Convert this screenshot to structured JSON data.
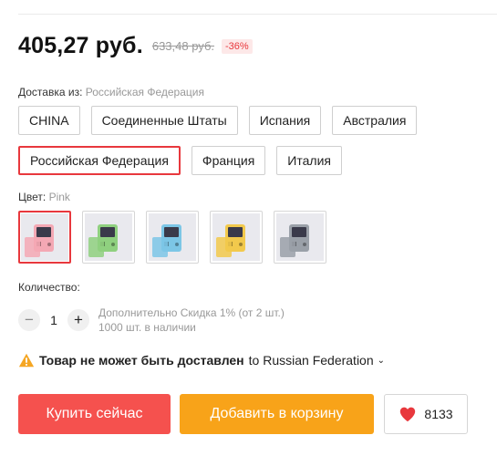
{
  "price": {
    "current": "405,27 руб.",
    "old": "633,48 руб.",
    "discount": "-36%"
  },
  "shipping": {
    "label": "Доставка из:",
    "selected": "Российская Федерация",
    "options": [
      "CHINA",
      "Соединенные Штаты",
      "Испания",
      "Австралия",
      "Российская Федерация",
      "Франция",
      "Италия"
    ],
    "active_index": 4
  },
  "color": {
    "label": "Цвет:",
    "selected": "Pink",
    "swatches": [
      {
        "name": "pink",
        "color": "#f4a8b4"
      },
      {
        "name": "green",
        "color": "#8fd07f"
      },
      {
        "name": "blue",
        "color": "#7cc6e6"
      },
      {
        "name": "yellow",
        "color": "#f2c94c"
      },
      {
        "name": "gray",
        "color": "#9aa0a8"
      }
    ],
    "active_index": 0
  },
  "quantity": {
    "label": "Количество:",
    "minus": "−",
    "plus": "+",
    "value": "1",
    "discount_text": "Дополнительно Скидка 1% (от 2 шт.)",
    "stock_text": "1000 шт. в наличии"
  },
  "warning": {
    "icon": "warning-triangle-icon",
    "strong_text": "Товар не может быть доставлен",
    "destination": "to Russian Federation",
    "chevron": "⌄"
  },
  "actions": {
    "buy_label": "Купить сейчас",
    "cart_label": "Добавить в корзину",
    "wish_count": "8133"
  },
  "colors": {
    "accent_red": "#e8383d",
    "buy_bg": "#f5514e",
    "cart_bg": "#f8a319",
    "heart": "#e8383d"
  }
}
